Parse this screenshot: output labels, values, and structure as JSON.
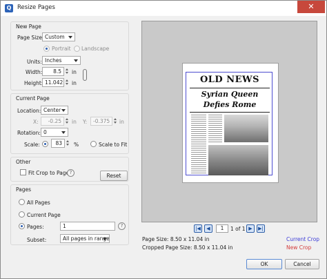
{
  "window": {
    "title": "Resize Pages",
    "close_glyph": "✕"
  },
  "new_page": {
    "group_title": "New Page",
    "page_size_label": "Page Size:",
    "page_size_value": "Custom",
    "portrait_label": "Portrait",
    "landscape_label": "Landscape",
    "units_label": "Units:",
    "units_value": "Inches",
    "width_label": "Width:",
    "width_value": "8.5",
    "width_unit": "in",
    "height_label": "Height:",
    "height_value": "11.042",
    "height_unit": "in"
  },
  "current_page": {
    "group_title": "Current Page",
    "location_label": "Location:",
    "location_value": "Center",
    "x_label": "X:",
    "x_value": "-0.25",
    "x_unit": "in",
    "y_label": "Y:",
    "y_value": "-0.375",
    "y_unit": "in",
    "rotation_label": "Rotation:",
    "rotation_value": "0",
    "scale_label": "Scale:",
    "scale_value": "83",
    "scale_unit": "%",
    "scale_to_fit_label": "Scale to Fit"
  },
  "other": {
    "group_title": "Other",
    "fit_crop_label": "Fit Crop to Page",
    "reset_label": "Reset"
  },
  "pages": {
    "group_title": "Pages",
    "all_pages_label": "All Pages",
    "current_page_label": "Current Page",
    "pages_label": "Pages:",
    "pages_value": "1",
    "subset_label": "Subset:",
    "subset_value": "All pages in range"
  },
  "preview": {
    "newspaper_title": "OLD NEWS",
    "headline_line1": "Syrian Queen",
    "headline_line2": "Defies Rome",
    "page_input": "1",
    "page_of": "1 of 1",
    "page_size_text": "Page Size: 8.50 x 11.04 in",
    "cropped_size_text": "Cropped Page Size: 8.50 x 11.04 in",
    "current_crop_label": "Current Crop",
    "new_crop_label": "New Crop"
  },
  "colors": {
    "current_crop": "#3b3bd6",
    "new_crop": "#d33b3b"
  },
  "help_glyph": "?",
  "footer": {
    "ok_label": "OK",
    "cancel_label": "Cancel"
  }
}
